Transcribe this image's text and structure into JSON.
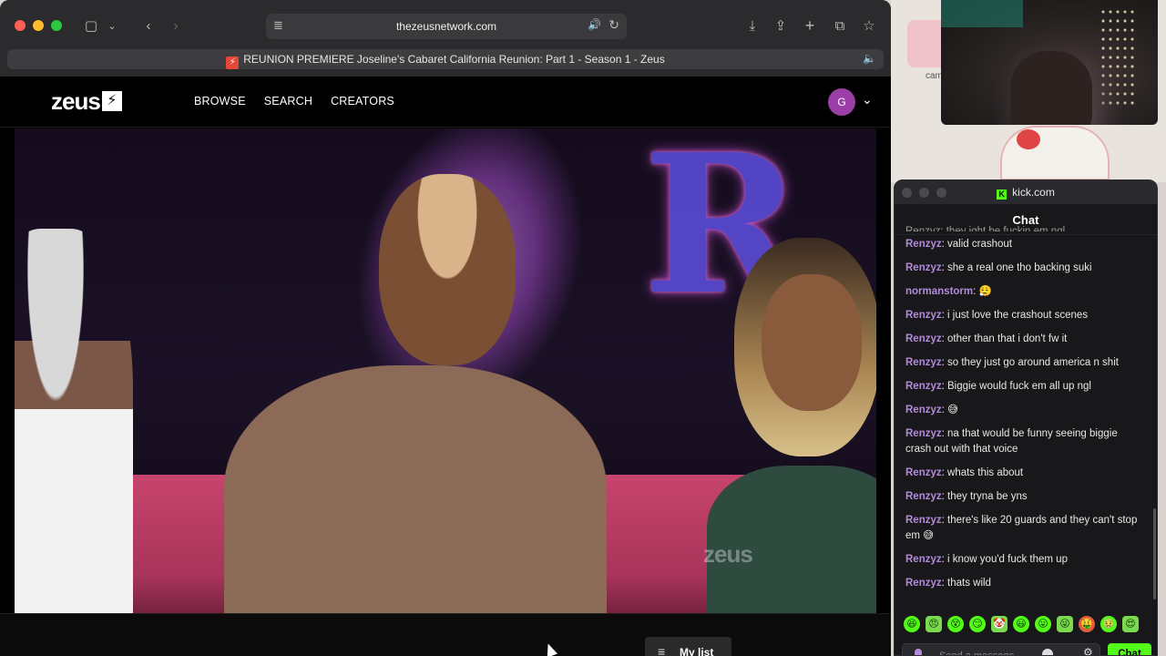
{
  "browser": {
    "url": "thezeusnetwork.com",
    "tab_title": "REUNION PREMIERE Joseline's Cabaret California Reunion: Part 1 - Season 1 - Zeus"
  },
  "site": {
    "logo": "zeus",
    "nav": [
      "BROWSE",
      "SEARCH",
      "CREATORS"
    ],
    "avatar_initial": "G",
    "video_watermark": "zeus",
    "mylist_label": "My list"
  },
  "desktop": {
    "icon_label": "cam"
  },
  "chat": {
    "site": "kick.com",
    "title": "Chat",
    "truncated_line": "Renzyz: they ight be fuckin em ngl",
    "username_color": "#b48bd9",
    "accent": "#53fc18",
    "messages": [
      {
        "user": "Renzyz",
        "text": "valid crashout"
      },
      {
        "user": "Renzyz",
        "text": "she a real one tho backing suki"
      },
      {
        "user": "normanstorm",
        "text": "😮‍💨"
      },
      {
        "user": "Renzyz",
        "text": "i just love the crashout scenes"
      },
      {
        "user": "Renzyz",
        "text": "other than that i don't fw it"
      },
      {
        "user": "Renzyz",
        "text": "so they just go around america n shit"
      },
      {
        "user": "Renzyz",
        "text": "Biggie would fuck em all up ngl"
      },
      {
        "user": "Renzyz",
        "text": "😅"
      },
      {
        "user": "Renzyz",
        "text": "na that would be funny seeing biggie crash out with that voice"
      },
      {
        "user": "Renzyz",
        "text": "whats this about"
      },
      {
        "user": "Renzyz",
        "text": "they tryna be yns"
      },
      {
        "user": "Renzyz",
        "text": "there's like 20 guards and they can't stop em 😅"
      },
      {
        "user": "Renzyz",
        "text": "i know you'd fuck them up"
      },
      {
        "user": "Renzyz",
        "text": "thats wild"
      }
    ],
    "emotes": [
      "😆",
      "😠",
      "😵",
      "😏",
      "🤡",
      "😃",
      "😛",
      "😜",
      "🤑",
      "🤢",
      "😍"
    ],
    "input_placeholder": "Send a message",
    "send_label": "Chat"
  }
}
